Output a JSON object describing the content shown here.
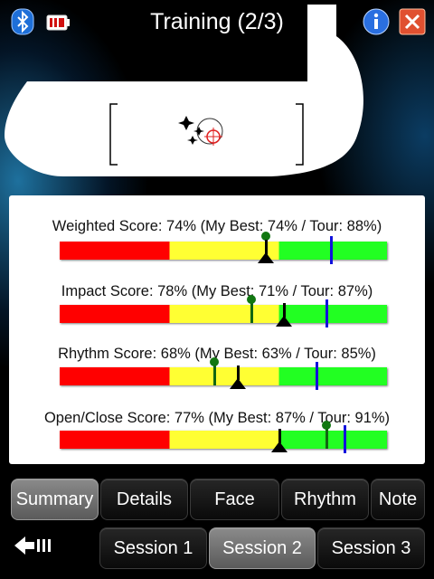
{
  "header": {
    "title": "Training (2/3)",
    "left_icons": [
      "bluetooth-icon",
      "battery-icon"
    ],
    "right_icons": [
      "info-icon",
      "close-icon"
    ]
  },
  "scores": [
    {
      "label": "Weighted Score: 74% (My Best: 74% / Tour: 88%)",
      "score": 74,
      "best": 74,
      "tour": 88
    },
    {
      "label": "Impact Score: 78% (My Best: 71% / Tour: 87%)",
      "score": 78,
      "best": 71,
      "tour": 87
    },
    {
      "label": "Rhythm Score: 68% (My Best: 63% / Tour: 85%)",
      "score": 68,
      "best": 63,
      "tour": 85
    },
    {
      "label": "Open/Close Score: 77% (My Best: 87% / Tour: 91%)",
      "score": 77,
      "best": 87,
      "tour": 91
    }
  ],
  "colors": {
    "red": "#ff0000",
    "yellow": "#ffff33",
    "green": "#22ff22",
    "tour_marker": "#1111dd",
    "best_marker": "#117711"
  },
  "tabs": [
    {
      "label": "Summary",
      "active": true
    },
    {
      "label": "Details",
      "active": false
    },
    {
      "label": "Face",
      "active": false
    },
    {
      "label": "Rhythm",
      "active": false
    },
    {
      "label": "Note",
      "active": false
    }
  ],
  "sessions": [
    {
      "label": "Session 1",
      "active": false
    },
    {
      "label": "Session 2",
      "active": true
    },
    {
      "label": "Session 3",
      "active": false
    }
  ],
  "back_icon": "back-arrow-icon"
}
